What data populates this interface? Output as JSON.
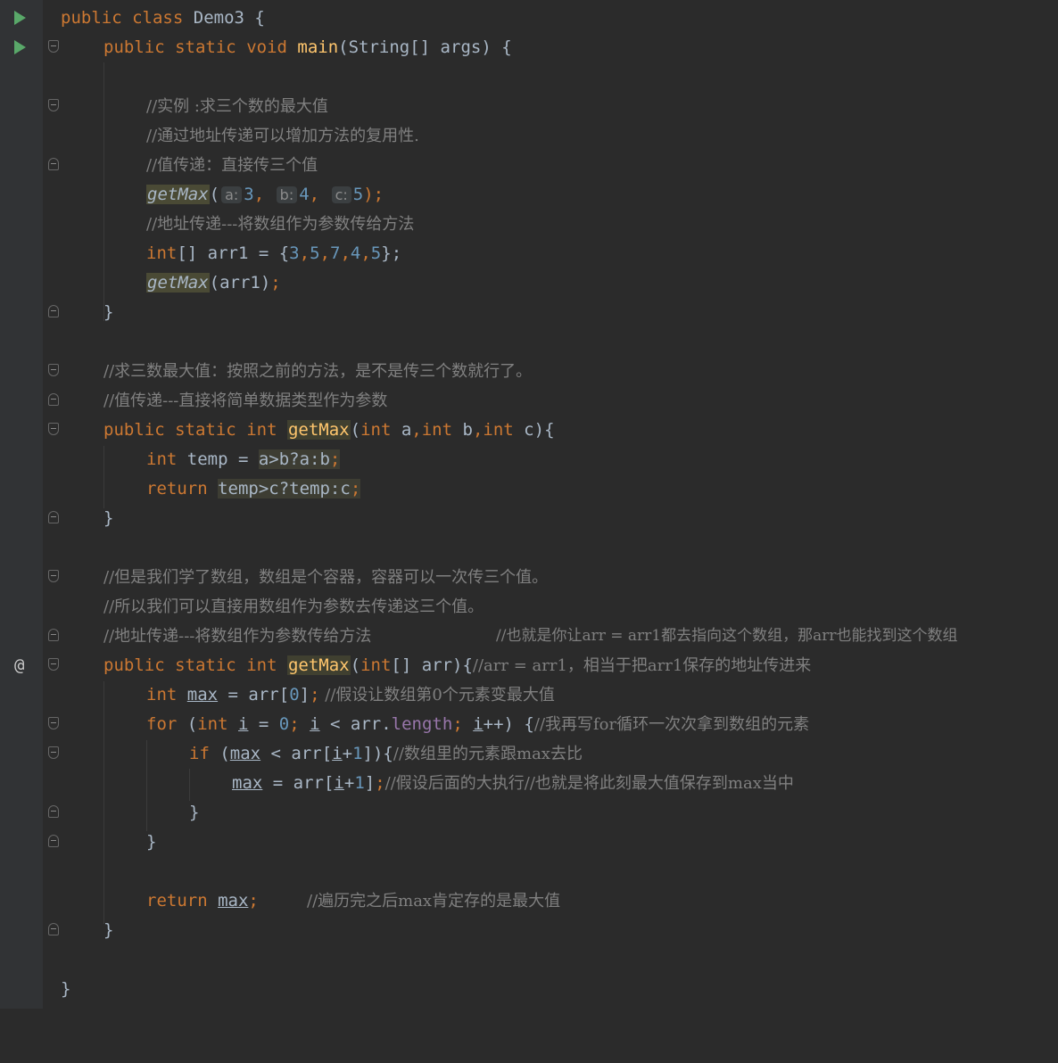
{
  "editor": {
    "class_decl": {
      "public": "public",
      "class": "class",
      "name": "Demo3",
      "brace": "{"
    },
    "main_decl": {
      "public": "public",
      "static": "static",
      "void": "void",
      "name": "main",
      "params": "(String[] args)",
      "brace": "{"
    },
    "c1": "//实例 :求三个数的最大值",
    "c2": "//通过地址传递可以增加方法的复用性.",
    "c3": "//值传递：直接传三个值",
    "call1": {
      "name": "getMax",
      "open": "(",
      "hint_a": "a:",
      "v_a": "3",
      "hint_b": "b:",
      "v_b": "4",
      "hint_c": "c:",
      "v_c": "5",
      "close": ");"
    },
    "c4": "//地址传递---将数组作为参数传给方法",
    "arr_decl": {
      "type": "int",
      "rest": "[] arr1 = {",
      "n1": "3",
      "n2": "5",
      "n3": "7",
      "n4": "4",
      "n5": "5",
      "end": "};"
    },
    "call2": {
      "name": "getMax",
      "args": "(arr1)",
      "semi": ";"
    },
    "close_brace": "}",
    "c5": "//求三数最大值：按照之前的方法，是不是传三个数就行了。",
    "c6": "//值传递---直接将简单数据类型作为参数",
    "m1_decl": {
      "public": "public",
      "static": "static",
      "int": "int",
      "name": "getMax",
      "open": "(",
      "int_a": "int",
      "a": " a",
      "comma1": ",",
      "int_b": "int",
      "b": " b",
      "comma2": ",",
      "int_c": "int",
      "c": " c",
      "close": "){"
    },
    "temp_line": {
      "int": "int",
      "name": " temp = ",
      "expr": "a>b?a:b",
      "semi": ";"
    },
    "return1": {
      "return": "return",
      "expr": "temp>c?temp:c",
      "semi": ";"
    },
    "c7": "//但是我们学了数组，数组是个容器，容器可以一次传三个值。",
    "c8": "//所以我们可以直接用数组作为参数去传递这三个值。",
    "c9": "//地址传递---将数组作为参数传给方法",
    "c9b": "//也就是你让arr = arr1都去指向这个数组，那arr也能找到这个数组",
    "m2_decl": {
      "public": "public",
      "static": "static",
      "int": "int",
      "name": "getMax",
      "open": "(",
      "int_kw": "int",
      "params": "[] arr){",
      "comment": "//arr = arr1，相当于把arr1保存的地址传进来"
    },
    "max_line": {
      "int": "int",
      "max": "max",
      "rest1": " = arr[",
      "zero": "0",
      "rest2": "]",
      "semi": ";",
      "comment": " //假设让数组第0个元素变最大值"
    },
    "for_line": {
      "for": "for",
      "open": " (",
      "int": "int",
      "i1": "i",
      "eq": " = ",
      "zero": "0",
      "semi1": ";",
      "i2": "i",
      "lt": " < arr.",
      "length": "length",
      "semi2": ";",
      "i3": "i",
      "pp": "++) {",
      "comment": "//我再写for循环一次次拿到数组的元素"
    },
    "if_line": {
      "if": "if",
      "open": " (",
      "max": "max",
      "lt": " < arr[",
      "i": "i",
      "plus": "+",
      "one": "1",
      "close": "]){",
      "comment": "//数组里的元素跟max去比"
    },
    "assign_line": {
      "max": "max",
      "eq": " = arr[",
      "i": "i",
      "plus": "+",
      "one": "1",
      "close": "]",
      "semi": ";",
      "comment": "//假设后面的大执行//也就是将此刻最大值保存到max当中"
    },
    "return2": {
      "return": "return",
      "max": "max",
      "semi": ";",
      "comment": "//遍历完之后max肯定存的是最大值"
    }
  }
}
